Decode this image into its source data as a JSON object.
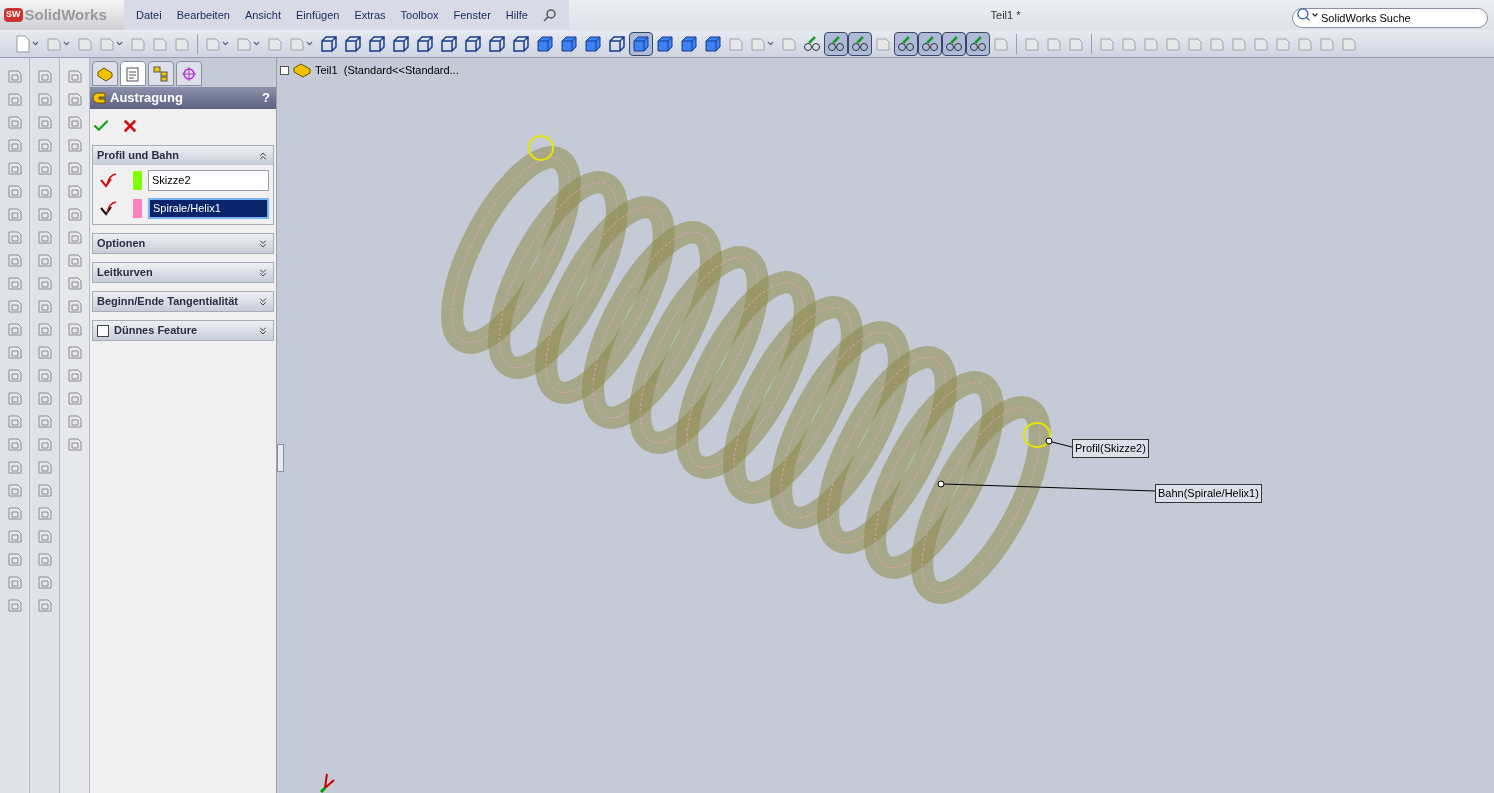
{
  "app": {
    "logo_badge": "SW",
    "logo": "SolidWorks",
    "menus": [
      "Datei",
      "Bearbeiten",
      "Ansicht",
      "Einfügen",
      "Extras",
      "Toolbox",
      "Fenster",
      "Hilfe"
    ],
    "title": "Teil1 *",
    "search": {
      "placeholder": "SolidWorks Suche"
    }
  },
  "toolbar": [
    {
      "kind": "doc_menu",
      "pressed": false
    },
    {
      "kind": "gray_menu",
      "pressed": false
    },
    {
      "kind": "gray",
      "pressed": false
    },
    {
      "kind": "gray_menu",
      "pressed": false
    },
    {
      "kind": "gray",
      "pressed": false
    },
    {
      "kind": "gray",
      "pressed": false
    },
    {
      "kind": "gray",
      "pressed": false
    },
    {
      "kind": "separator"
    },
    {
      "kind": "gray_menu",
      "pressed": false
    },
    {
      "kind": "gray_menu",
      "pressed": false
    },
    {
      "kind": "gray",
      "pressed": false
    },
    {
      "kind": "gray_menu",
      "pressed": false
    },
    {
      "kind": "wire",
      "pressed": false
    },
    {
      "kind": "wire",
      "pressed": false
    },
    {
      "kind": "wire",
      "pressed": false
    },
    {
      "kind": "wire",
      "pressed": false
    },
    {
      "kind": "wire",
      "pressed": false
    },
    {
      "kind": "wire",
      "pressed": false
    },
    {
      "kind": "wire",
      "pressed": false
    },
    {
      "kind": "wire",
      "pressed": false
    },
    {
      "kind": "wire",
      "pressed": false
    },
    {
      "kind": "solid",
      "pressed": false
    },
    {
      "kind": "solid",
      "pressed": false
    },
    {
      "kind": "solid",
      "pressed": false
    },
    {
      "kind": "wire",
      "pressed": false
    },
    {
      "kind": "solid",
      "pressed": true
    },
    {
      "kind": "solid",
      "pressed": false
    },
    {
      "kind": "solid",
      "pressed": false
    },
    {
      "kind": "solid",
      "pressed": false
    },
    {
      "kind": "gray",
      "pressed": false
    },
    {
      "kind": "gray_menu",
      "pressed": false
    },
    {
      "kind": "gray",
      "pressed": false
    },
    {
      "kind": "sketch",
      "pressed": false
    },
    {
      "kind": "sketch",
      "pressed": true
    },
    {
      "kind": "sketch",
      "pressed": true
    },
    {
      "kind": "gray",
      "pressed": false
    },
    {
      "kind": "sketch",
      "pressed": true
    },
    {
      "kind": "sketch",
      "pressed": true
    },
    {
      "kind": "sketch",
      "pressed": true
    },
    {
      "kind": "sketch",
      "pressed": true
    },
    {
      "kind": "gray",
      "pressed": false
    },
    {
      "kind": "separator"
    },
    {
      "kind": "gray",
      "pressed": false
    },
    {
      "kind": "gray",
      "pressed": false
    },
    {
      "kind": "gray",
      "pressed": false
    },
    {
      "kind": "separator"
    },
    {
      "kind": "gray",
      "pressed": false
    },
    {
      "kind": "gray",
      "pressed": false
    },
    {
      "kind": "gray",
      "pressed": false
    },
    {
      "kind": "gray",
      "pressed": false
    },
    {
      "kind": "gray",
      "pressed": false
    },
    {
      "kind": "gray",
      "pressed": false
    },
    {
      "kind": "gray",
      "pressed": false
    },
    {
      "kind": "gray",
      "pressed": false
    },
    {
      "kind": "gray",
      "pressed": false
    },
    {
      "kind": "gray",
      "pressed": false
    },
    {
      "kind": "gray",
      "pressed": false
    },
    {
      "kind": "gray",
      "pressed": false
    }
  ],
  "manager_tabs": [
    {
      "kind": "feature",
      "selected": false
    },
    {
      "kind": "property",
      "selected": true
    },
    {
      "kind": "config",
      "selected": false
    },
    {
      "kind": "target",
      "selected": false
    }
  ],
  "property_manager": {
    "title": "Austragung",
    "help": "?",
    "sections": [
      {
        "title": "Profil und Bahn",
        "expanded": true,
        "fields": [
          {
            "value": "Skizze2",
            "color": "#80ff00",
            "selected": false
          },
          {
            "value": "Spirale/Helix1",
            "color": "#ff80c0",
            "selected": true
          }
        ]
      },
      {
        "title": "Optionen",
        "expanded": false
      },
      {
        "title": "Leitkurven",
        "expanded": false
      },
      {
        "title": "Beginn/Ende Tangentialität",
        "expanded": false
      },
      {
        "title": "Dünnes Feature",
        "expanded": false,
        "checkbox": {
          "checked": false
        }
      }
    ]
  },
  "feature_tree": {
    "label": "Teil1  (Standard<<Standard..."
  },
  "callouts": [
    {
      "label": "Profil(Skizze2)"
    },
    {
      "label": "Bahn(Spirale/Helix1)"
    }
  ]
}
